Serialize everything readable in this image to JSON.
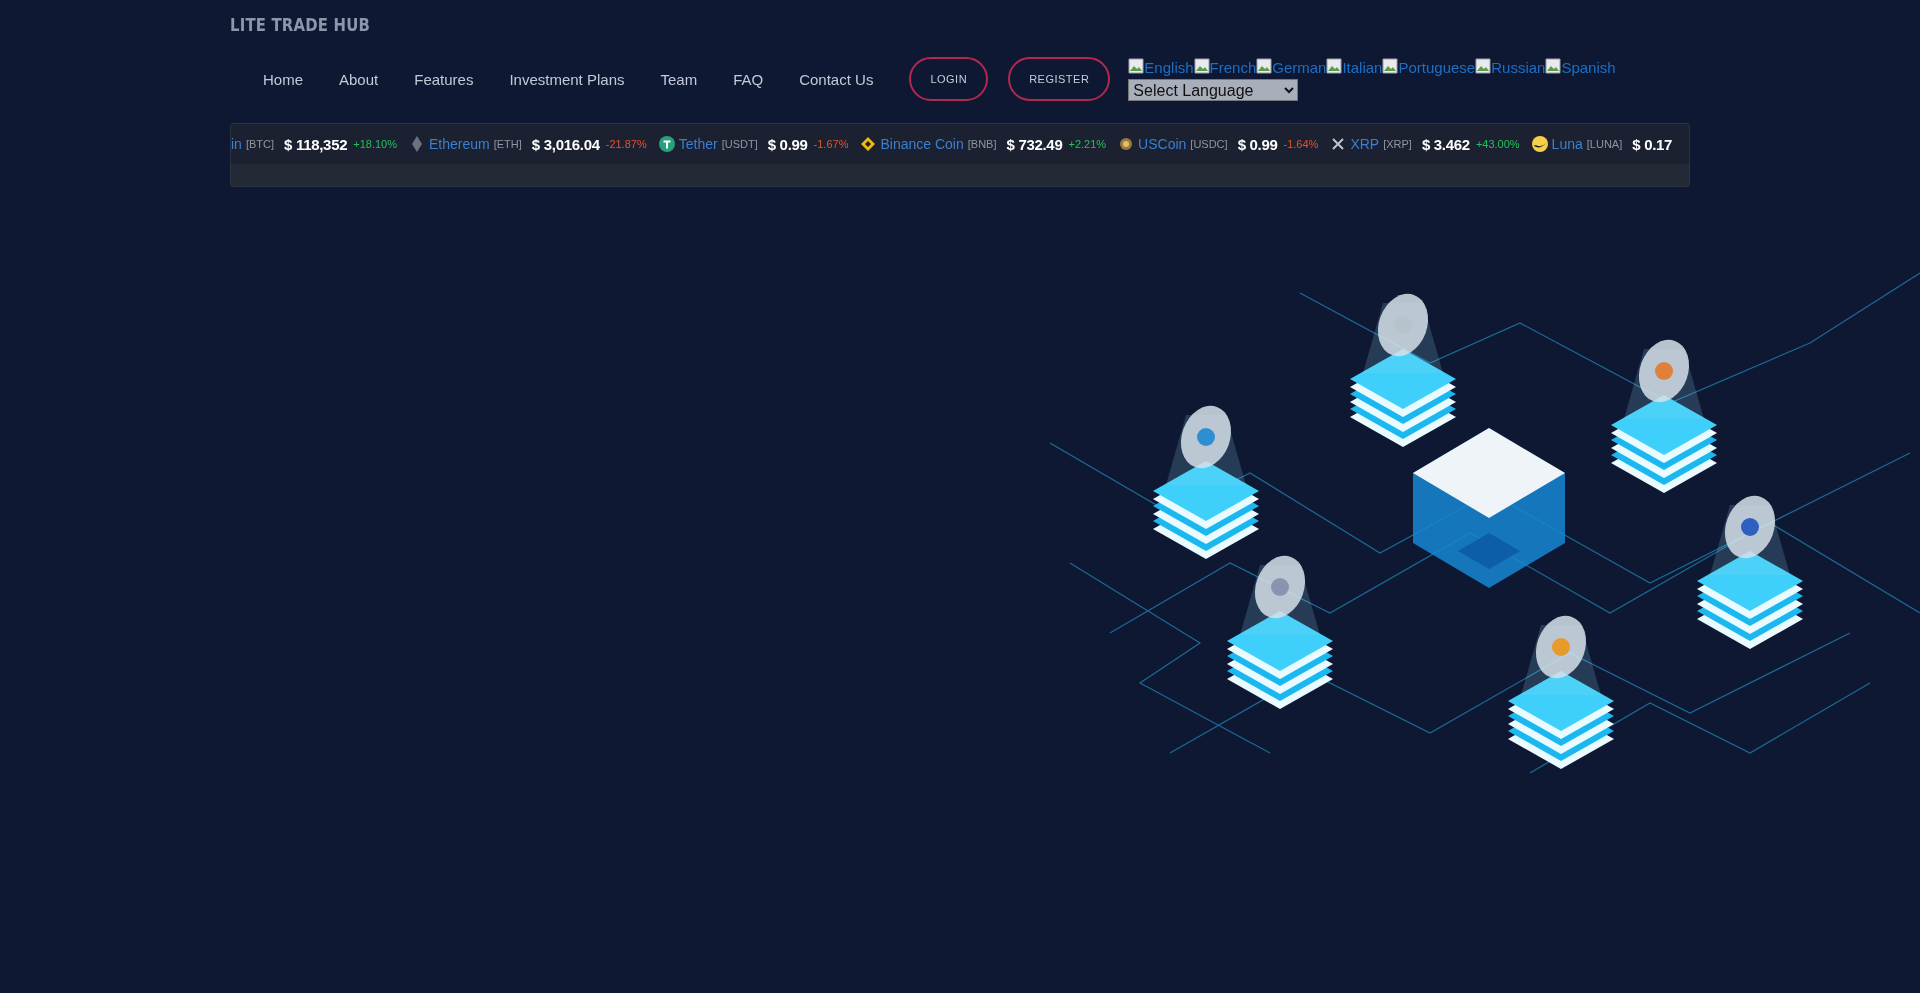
{
  "logo": "LITE TRADE HUB",
  "nav": [
    {
      "label": "Home"
    },
    {
      "label": "About"
    },
    {
      "label": "Features"
    },
    {
      "label": "Investment Plans"
    },
    {
      "label": "Team"
    },
    {
      "label": "FAQ"
    },
    {
      "label": "Contact Us"
    }
  ],
  "buttons": [
    {
      "label": "LOGIN"
    },
    {
      "label": "REGISTER"
    }
  ],
  "languages": [
    {
      "label": "English"
    },
    {
      "label": "French"
    },
    {
      "label": "German"
    },
    {
      "label": "Italian"
    },
    {
      "label": "Portuguese"
    },
    {
      "label": "Russian"
    },
    {
      "label": "Spanish"
    }
  ],
  "language_select": {
    "value": "Select Language"
  },
  "ticker": [
    {
      "kind": "plain",
      "name": "in",
      "symbol": "[BTC]",
      "price": "$ 118,352",
      "change": "+18.10%",
      "color": "#23c05a"
    },
    {
      "kind": "eth",
      "name": "Ethereum",
      "symbol": "[ETH]",
      "price": "$ 3,016.04",
      "change": "-21.87%",
      "color": "#e8522c"
    },
    {
      "kind": "usdt",
      "name": "Tether",
      "symbol": "[USDT]",
      "price": "$ 0.99",
      "change": "-1.67%",
      "color": "#e8522c"
    },
    {
      "kind": "bnb",
      "name": "Binance Coin",
      "symbol": "[BNB]",
      "price": "$ 732.49",
      "change": "+2.21%",
      "color": "#23c05a"
    },
    {
      "kind": "usdc",
      "name": "USCoin",
      "symbol": "[USDC]",
      "price": "$ 0.99",
      "change": "-1.64%",
      "color": "#e8522c"
    },
    {
      "kind": "xrp",
      "name": "XRP",
      "symbol": "[XRP]",
      "price": "$ 3.462",
      "change": "+43.00%",
      "color": "#23c05a"
    },
    {
      "kind": "luna",
      "name": "Luna",
      "symbol": "[LUNA]",
      "price": "$ 0.17"
    }
  ]
}
